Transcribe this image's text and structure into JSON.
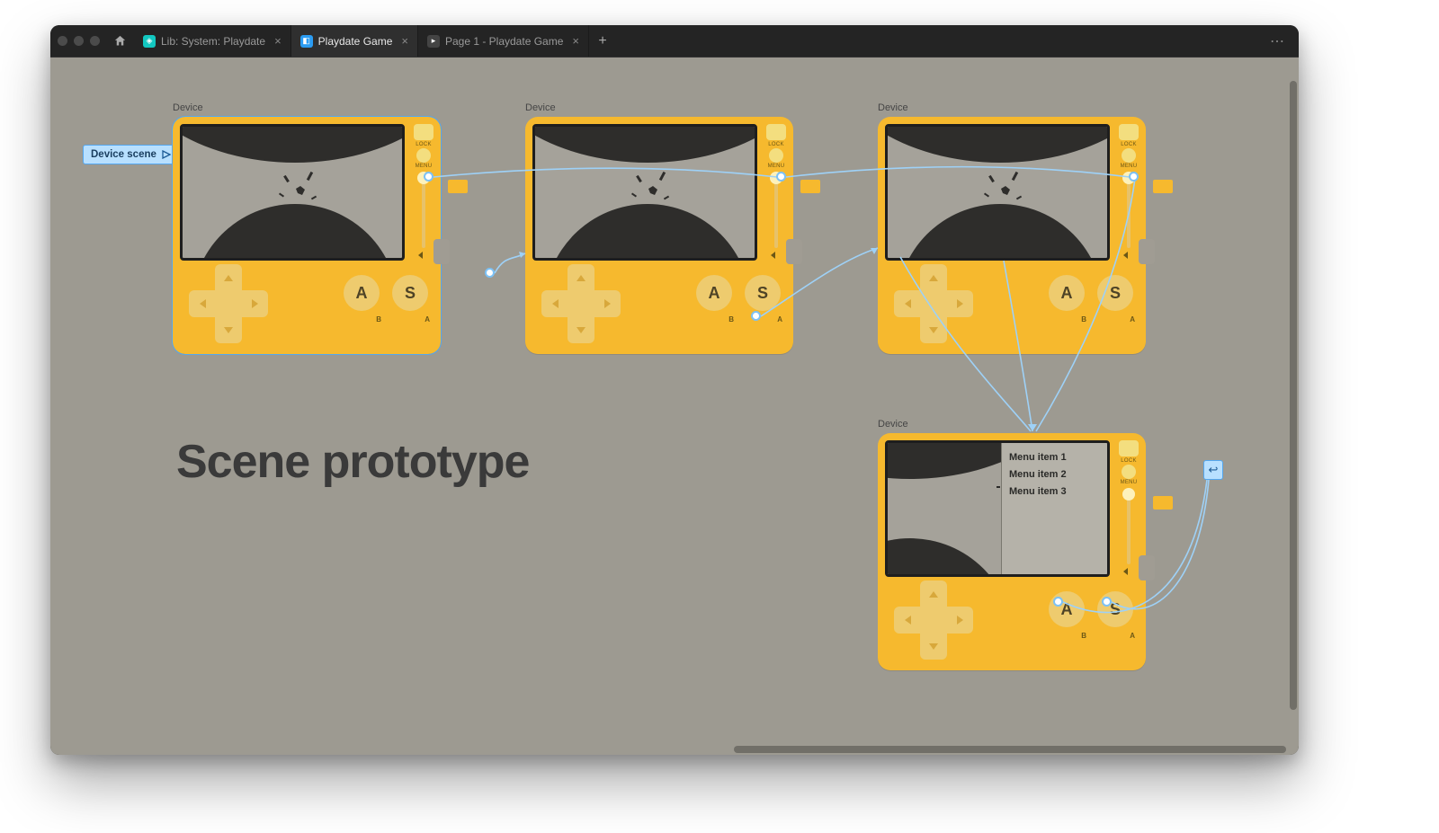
{
  "tabs": [
    {
      "label": "Lib: System: Playdate"
    },
    {
      "label": "Playdate Game"
    },
    {
      "label": "Page 1 - Playdate Game"
    }
  ],
  "flow_badge": "Device scene",
  "frame_label": "Device",
  "scene_title": "Scene prototype",
  "side": {
    "lock": "LOCK",
    "menu": "MENU"
  },
  "buttons": {
    "a_face": "A",
    "s_face": "S",
    "a_sub": "B",
    "s_sub": "A"
  },
  "menu_items": [
    "Menu item 1",
    "Menu item 2",
    "Menu item 3"
  ]
}
